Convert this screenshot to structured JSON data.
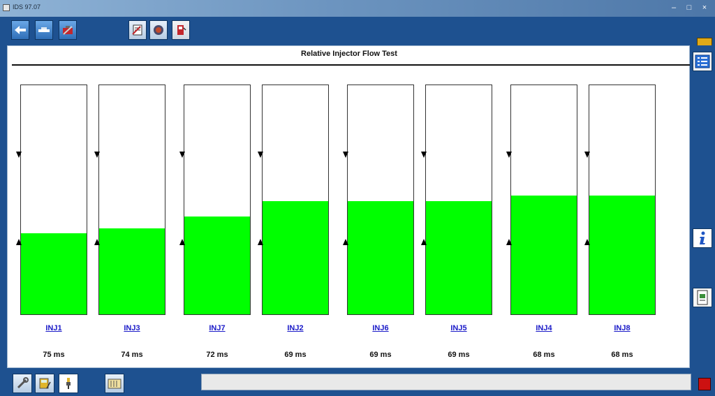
{
  "window": {
    "title": "IDS 97.07",
    "minimize": "–",
    "maximize": "□",
    "close": "×"
  },
  "toolbar": {
    "buttons": [
      {
        "id": "back",
        "icon": "back-arrow-icon"
      },
      {
        "id": "vehicle",
        "icon": "vehicle-icon"
      },
      {
        "id": "tools",
        "icon": "toolbox-icon"
      },
      {
        "id": "doc",
        "icon": "datalogger-icon"
      },
      {
        "id": "gauge",
        "icon": "gauge-icon"
      },
      {
        "id": "fuel",
        "icon": "fuel-pump-icon"
      }
    ]
  },
  "main": {
    "title": "Relative Injector Flow Test",
    "injectors": [
      {
        "name": "INJ1",
        "value": "75 ms",
        "fill": 0.355
      },
      {
        "name": "INJ3",
        "value": "74 ms",
        "fill": 0.376
      },
      {
        "name": "INJ7",
        "value": "72 ms",
        "fill": 0.427
      },
      {
        "name": "INJ2",
        "value": "69 ms",
        "fill": 0.494
      },
      {
        "name": "INJ6",
        "value": "69 ms",
        "fill": 0.494
      },
      {
        "name": "INJ5",
        "value": "69 ms",
        "fill": 0.494
      },
      {
        "name": "INJ4",
        "value": "68 ms",
        "fill": 0.518
      },
      {
        "name": "INJ8",
        "value": "68 ms",
        "fill": 0.518
      }
    ]
  },
  "sidebar": {
    "buttons": [
      "list-icon",
      "info-icon",
      "document-icon"
    ]
  },
  "bottombar": {
    "buttons": [
      "wrench-icon",
      "multimeter-icon",
      "probe-icon",
      "battery-icon"
    ],
    "status": ""
  },
  "colors": {
    "fill": "#00ff00",
    "link": "#1a1ac8",
    "frame": "#1e5190"
  }
}
